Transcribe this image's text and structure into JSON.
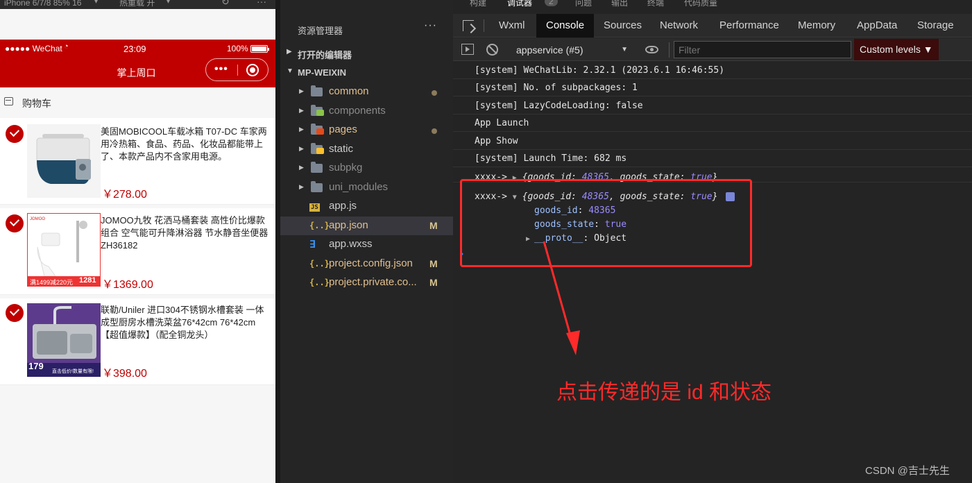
{
  "simulator": {
    "top_bar": {
      "device": "iPhone 6/7/8 85% 16",
      "reload": "热重载 开"
    },
    "status_bar": {
      "carrier": "●●●●● WeChat",
      "time": "23:09",
      "battery": "100%"
    },
    "nav_title": "掌上周口",
    "capsule": {
      "more": "•••"
    },
    "cart_title": "购物车",
    "items": [
      {
        "name": "美固MOBICOOL车载冰箱 T07-DC 车家两用冷热箱、食品、药品、化妆品都能带上了、本款产品内不含家用电源。",
        "price": "￥278.00",
        "checked": true
      },
      {
        "name": "JOMOO九牧 花洒马桶套装 高性价比爆款组合 空气能可升降淋浴器 节水静音坐便器 ZH36182",
        "price": "￥1369.00",
        "checked": true,
        "thumb_text": "满1499减220元",
        "thumb_price": "1281"
      },
      {
        "name": "联勒/Uniler 进口304不锈钢水槽套装 一体成型厨房水槽洗菜盆76*42cm 76*42cm【超值爆款】（配全铜龙头）",
        "price": "￥398.00",
        "checked": true,
        "thumb_text": "179",
        "thumb_sub": "直击低价!数量有限!"
      }
    ]
  },
  "explorer": {
    "title": "资源管理器",
    "more": "···",
    "sections": {
      "open_editors": "打开的编辑器",
      "project": "MP-WEIXIN"
    },
    "entries": [
      {
        "name": "common",
        "type": "folder",
        "color": "#e2c08d",
        "dot": true
      },
      {
        "name": "components",
        "type": "folder",
        "color": "#8b8b8b",
        "badge": "#8bc34a"
      },
      {
        "name": "pages",
        "type": "folder",
        "color": "#e2c08d",
        "badge": "#e64a19",
        "dot": true
      },
      {
        "name": "static",
        "type": "folder",
        "color": "#cccccc",
        "badge": "#fbc02d"
      },
      {
        "name": "subpkg",
        "type": "folder",
        "color": "#8b8b8b"
      },
      {
        "name": "uni_modules",
        "type": "folder",
        "color": "#8b8b8b"
      },
      {
        "name": "app.js",
        "type": "file",
        "icon": "JS",
        "color": "#cccccc"
      },
      {
        "name": "app.json",
        "type": "file",
        "icon": "{..}",
        "color": "#e2c08d",
        "mod": "M",
        "selected": true
      },
      {
        "name": "app.wxss",
        "type": "file",
        "icon": "css",
        "color": "#cccccc"
      },
      {
        "name": "project.config.json",
        "type": "file",
        "icon": "{..}",
        "color": "#e2c08d",
        "mod": "M"
      },
      {
        "name": "project.private.co...",
        "type": "file",
        "icon": "{..}",
        "color": "#e2c08d",
        "mod": "M"
      }
    ]
  },
  "devtools": {
    "top_tabs": [
      "构建",
      "调试器",
      "2",
      "问题",
      "输出",
      "终端",
      "代码质量"
    ],
    "tabs": [
      "Wxml",
      "Console",
      "Sources",
      "Network",
      "Performance",
      "Memory",
      "AppData",
      "Storage"
    ],
    "active_tab": "Console",
    "context": "appservice (#5)",
    "filter_placeholder": "Filter",
    "levels": "Custom levels ▼",
    "logs": [
      "[system] WeChatLib: 2.32.1 (2023.6.1 16:46:55)",
      "[system] No. of subpackages: 1",
      "[system] LazyCodeLoading: false",
      "App Launch",
      "App Show",
      "[system] Launch Time: 682 ms"
    ],
    "obj_prefix": "xxxx->",
    "obj_preview": {
      "open": "{",
      "k1": "goods_id",
      "v1": "48365",
      "sep": ", ",
      "k2": "goods_state",
      "v2": "true",
      "close": "}"
    },
    "expanded": {
      "k1": "goods_id",
      "v1": "48365",
      "k2": "goods_state",
      "v2": "true",
      "proto_key": "__proto__",
      "proto_val": "Object"
    },
    "prompt": "›"
  },
  "annotation": "点击传递的是 id 和状态",
  "watermark": "CSDN @吉士先生",
  "colors": {
    "brand_red": "#c00000",
    "annotation_red": "#ff2a2a"
  }
}
